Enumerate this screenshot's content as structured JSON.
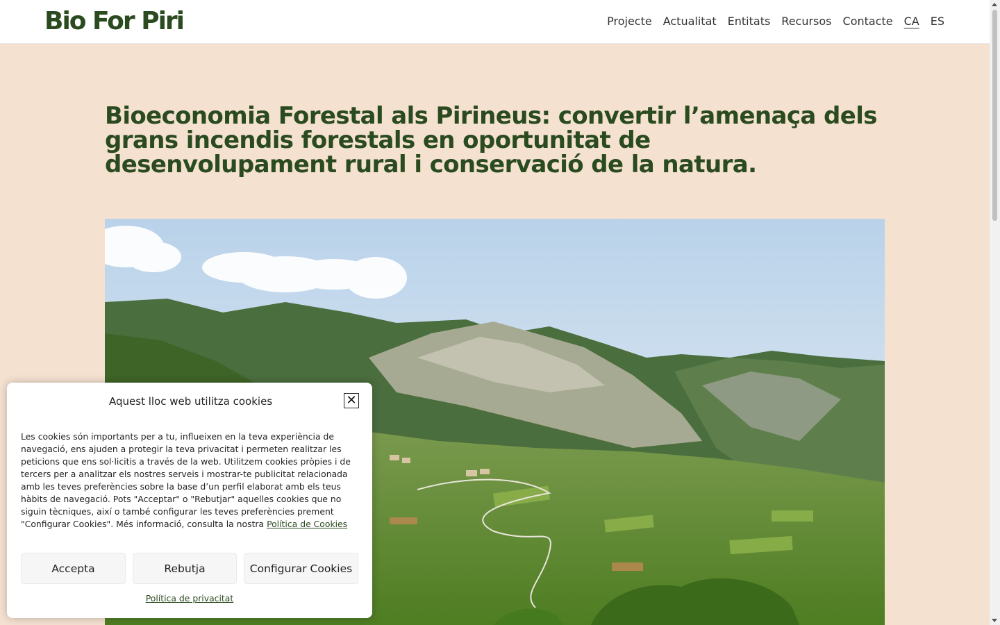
{
  "header": {
    "logo": "Bio For Piri",
    "nav": [
      {
        "label": "Projecte"
      },
      {
        "label": "Actualitat"
      },
      {
        "label": "Entitats"
      },
      {
        "label": "Recursos"
      },
      {
        "label": "Contacte"
      },
      {
        "label": "CA",
        "active": true
      },
      {
        "label": "ES"
      }
    ]
  },
  "main": {
    "title": "Bioeconomia Forestal als Pirineus: convertir l’amenaça dels grans incendis forestals en oportunitat de desenvolupament rural i conservació de la natura.",
    "hero_image": "mountain-landscape"
  },
  "cookie_banner": {
    "title": "Aquest lloc web utilitza cookies",
    "text": "Les cookies són importants per a tu, influeixen en la teva experiència de navegació, ens ajuden a protegir la teva privacitat i permeten realitzar les peticions que ens sol·licitis a través de la web. Utilitzem cookies pròpies i de tercers per a analitzar els nostres serveis i mostrar-te publicitat relacionada amb les teves preferències sobre la base d’un perfil elaborat amb els teus hàbits de navegació. Pots \"Acceptar\" o \"Rebutjar\" aquelles cookies que no siguin tècniques, així o també configurar les teves preferències prement \"Configurar Cookies\". Més informació, consulta la nostra",
    "cookie_policy_link": "Política de Cookies",
    "accept_label": "Accepta",
    "reject_label": "Rebutja",
    "configure_label": "Configurar Cookies",
    "privacy_link": "Política de privacitat",
    "close_icon": "close-icon"
  },
  "colors": {
    "brand_green": "#2a4a1f",
    "page_background": "#f5e1d0"
  }
}
